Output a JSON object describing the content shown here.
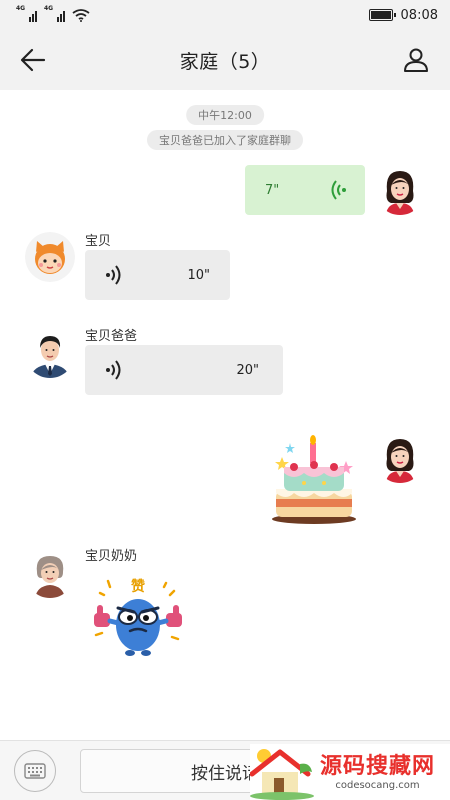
{
  "status_bar": {
    "signal1_tag": "4G",
    "signal2_tag": "4G",
    "time": "08:08",
    "battery_level": 1.0
  },
  "header": {
    "title": "家庭（5）",
    "back_icon": "arrow-left-icon",
    "members_icon": "user-icon"
  },
  "chat": {
    "timestamp": "中午12:00",
    "system_notice": "宝贝爸爸已加入了家庭群聊",
    "messages": [
      {
        "from": "me",
        "type": "voice",
        "duration": "7\""
      },
      {
        "from": "宝贝",
        "type": "voice",
        "duration": "10\""
      },
      {
        "from": "宝贝爸爸",
        "type": "voice",
        "duration": "20\""
      },
      {
        "from": "me",
        "type": "sticker",
        "sticker": "birthday-cake"
      },
      {
        "from": "宝贝奶奶",
        "type": "sticker",
        "sticker": "thumbs-up-monster",
        "sticker_text": "赞"
      }
    ]
  },
  "bottom_bar": {
    "keyboard_icon": "keyboard-icon",
    "hold_to_talk": "按住说话"
  },
  "watermark": {
    "title": "源码搜藏网",
    "url": "codesocang.com"
  },
  "colors": {
    "header_bg": "#f2f2f2",
    "outgoing_bubble": "#d8f2d2",
    "incoming_bubble": "#ececec",
    "voice_green": "#2e9e3a",
    "watermark_red": "#e8302c"
  }
}
